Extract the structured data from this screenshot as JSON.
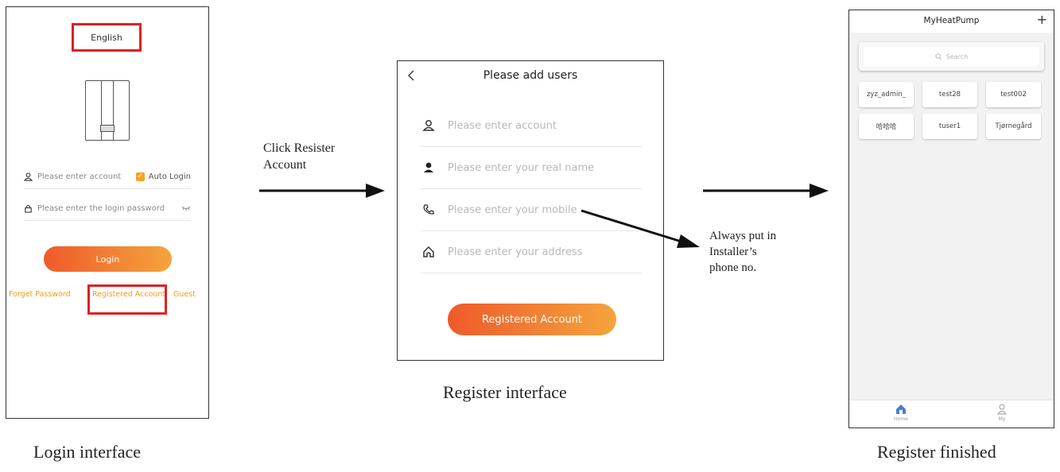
{
  "login": {
    "language": "English",
    "account_placeholder": "Please enter account",
    "auto_login": "Auto Login",
    "password_placeholder": "Please enter the login password",
    "login_button": "Login",
    "forget_password": "Forget Password",
    "registered_account": "Registered Account",
    "guest": "Guest",
    "caption": "Login interface"
  },
  "step1": {
    "instruction_line1": "Click Resister",
    "instruction_line2": "Account"
  },
  "register": {
    "title": "Please add users",
    "fields": [
      {
        "placeholder": "Please enter account",
        "icon": "user-outline-icon"
      },
      {
        "placeholder": "Please enter your real name",
        "icon": "user-filled-icon"
      },
      {
        "placeholder": "Please enter your mobile",
        "icon": "phone-icon"
      },
      {
        "placeholder": "Please enter your address",
        "icon": "home-icon"
      }
    ],
    "button": "Registered Account",
    "caption": "Register interface"
  },
  "note": {
    "line1": "Always put in",
    "line2": "Installer’s",
    "line3": "phone no."
  },
  "finished": {
    "title": "MyHeatPump",
    "search_placeholder": "Search",
    "users": [
      "zyz_admin_",
      "test28",
      "test002",
      "哈哈哈",
      "tuser1",
      "Tjørnegård"
    ],
    "tab_home": "Home",
    "tab_my": "My",
    "caption": "Register finished"
  },
  "colors": {
    "accent_start": "#ef5a2b",
    "accent_end": "#f4a43c",
    "highlight_box": "#e02020",
    "link": "#f39c1f",
    "home_tab": "#4a7fd1"
  }
}
